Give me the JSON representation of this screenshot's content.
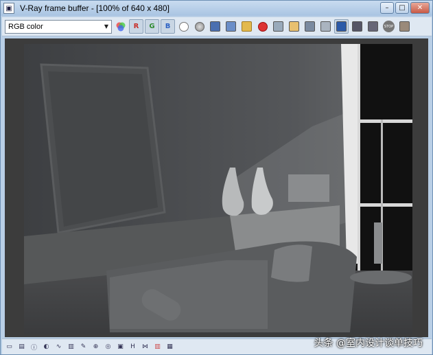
{
  "window": {
    "title": "V-Ray frame buffer - [100% of 640 x 480]",
    "controls": {
      "minimize": "–",
      "maximize": "□",
      "close": "✕"
    }
  },
  "toolbar": {
    "channel_select": {
      "value": "RGB color"
    },
    "buttons": [
      {
        "name": "color-wheel-icon",
        "label": ""
      },
      {
        "name": "red-channel-icon",
        "label": "R",
        "color": "#c8302a"
      },
      {
        "name": "green-channel-icon",
        "label": "G",
        "color": "#2e8a2e"
      },
      {
        "name": "blue-channel-icon",
        "label": "B",
        "color": "#2d62c4"
      },
      {
        "name": "white-circle-icon",
        "label": ""
      },
      {
        "name": "gray-circle-icon",
        "label": ""
      },
      {
        "name": "save-image-icon",
        "label": ""
      },
      {
        "name": "save-all-icon",
        "label": ""
      },
      {
        "name": "open-folder-icon",
        "label": ""
      },
      {
        "name": "clear-icon",
        "label": ""
      },
      {
        "name": "duplicate-icon",
        "label": ""
      },
      {
        "name": "track-mouse-icon",
        "label": ""
      },
      {
        "name": "render-region-icon",
        "label": ""
      },
      {
        "name": "link-icon",
        "label": ""
      },
      {
        "name": "display-correction-icon",
        "label": ""
      },
      {
        "name": "region-render-icon",
        "label": ""
      },
      {
        "name": "options-icon",
        "label": ""
      },
      {
        "name": "stop-icon",
        "label": "STOP"
      },
      {
        "name": "render-icon",
        "label": ""
      }
    ]
  },
  "statusbar": {
    "icons": [
      "panel-icon",
      "history-icon",
      "info-icon",
      "levels-icon",
      "curves-icon",
      "histogram-icon",
      "brush-icon",
      "target-icon",
      "lens-icon",
      "region-icon",
      "h-icon",
      "mirror-icon",
      "stripes-icon",
      "grid-icon"
    ],
    "h_label": "H"
  },
  "watermark": "头条 @室内设计谈单技巧"
}
